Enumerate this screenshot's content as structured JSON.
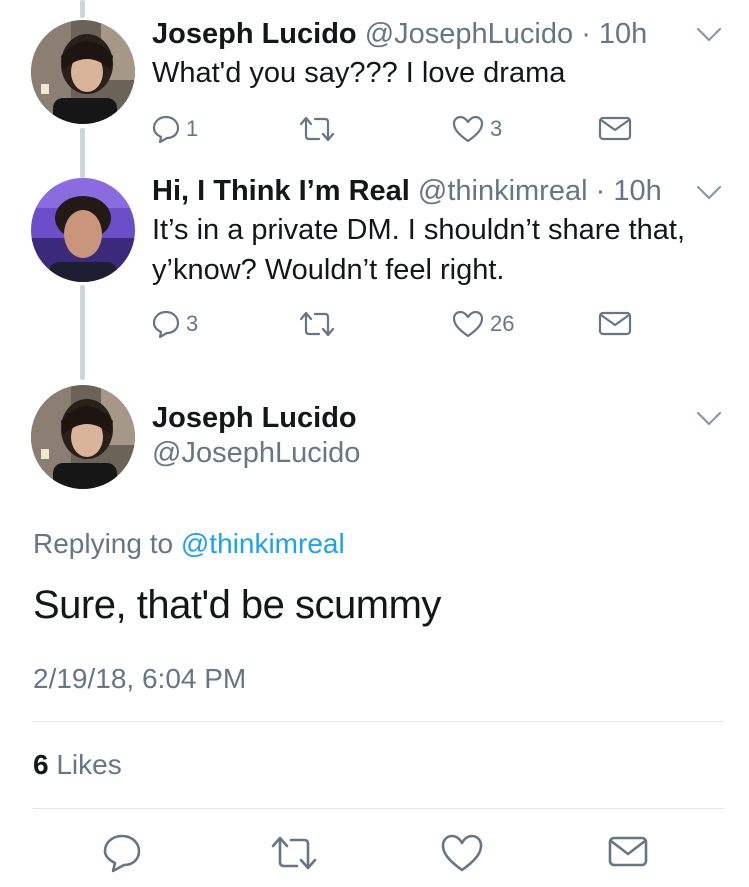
{
  "tweets": [
    {
      "name": "Joseph Lucido",
      "handle": "@JosephLucido",
      "time": "· 10h",
      "text": "What'd you say??? I love drama",
      "replies": "1",
      "retweets": "",
      "likes": "3"
    },
    {
      "name": "Hi, I Think I’m Real",
      "handle": "@thinkimreal",
      "time": "· 10h",
      "text": "It’s in a private DM. I shouldn’t share that, y’know? Wouldn’t feel right.",
      "replies": "3",
      "retweets": "",
      "likes": "26"
    }
  ],
  "focus": {
    "name": "Joseph Lucido",
    "handle": "@JosephLucido",
    "replying_prefix": "Replying to",
    "replying_to": "@thinkimreal",
    "text": "Sure, that'd be scummy",
    "timestamp": "2/19/18, 6:04 PM",
    "likes_count": "6",
    "likes_label": "Likes"
  },
  "colors": {
    "text": "#14171a",
    "secondary": "#657786",
    "link": "#1da1f2",
    "thread_line": "#ccd6dd",
    "divider": "#e1e8ed"
  },
  "icons": [
    "reply-icon",
    "retweet-icon",
    "like-icon",
    "direct-message-icon",
    "chevron-down-icon"
  ]
}
